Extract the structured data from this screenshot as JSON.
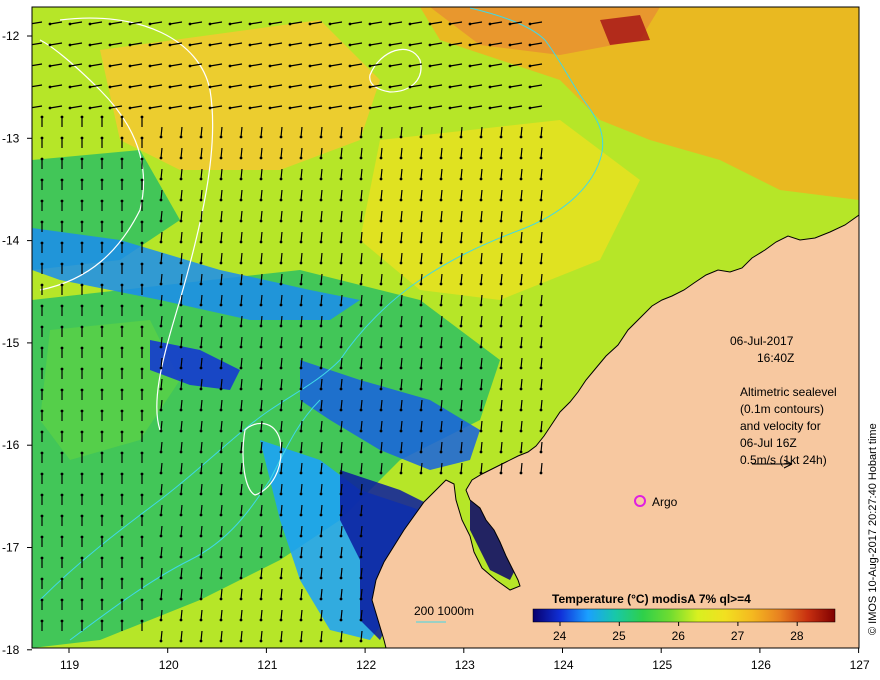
{
  "map": {
    "lon_ticks": [
      "119",
      "120",
      "121",
      "122",
      "123",
      "124",
      "125",
      "126",
      "127"
    ],
    "lat_ticks": [
      "-12",
      "-13",
      "-14",
      "-15",
      "-16",
      "-17",
      "-18"
    ],
    "date": "06-Jul-2017",
    "time": "16:40Z",
    "altimetry_lines": [
      "Altimetric sealevel",
      "(0.1m contours)",
      "and velocity for",
      "06-Jul 16Z",
      "0.5m/s (1kt 24h)"
    ],
    "argo_label": "Argo",
    "depth_label": "200 1000m",
    "credit": "© IMOS 10-Aug-2017 20:27:40 Hobart time",
    "colors": {
      "land": "#f7c8a0",
      "depth_contour": "#40d8e8",
      "argo": "#e020e0",
      "coast": "#000000"
    }
  },
  "colorbar": {
    "title": "Temperature (°C) modisA 7% ql>=4",
    "ticks": [
      "24",
      "25",
      "26",
      "27",
      "28"
    ],
    "stops": [
      "#08006c",
      "#1030d8",
      "#1aa0ff",
      "#18c8a8",
      "#2ed04a",
      "#70dc30",
      "#d8f020",
      "#f2e020",
      "#f4b820",
      "#e88020",
      "#c83010",
      "#800000"
    ]
  }
}
